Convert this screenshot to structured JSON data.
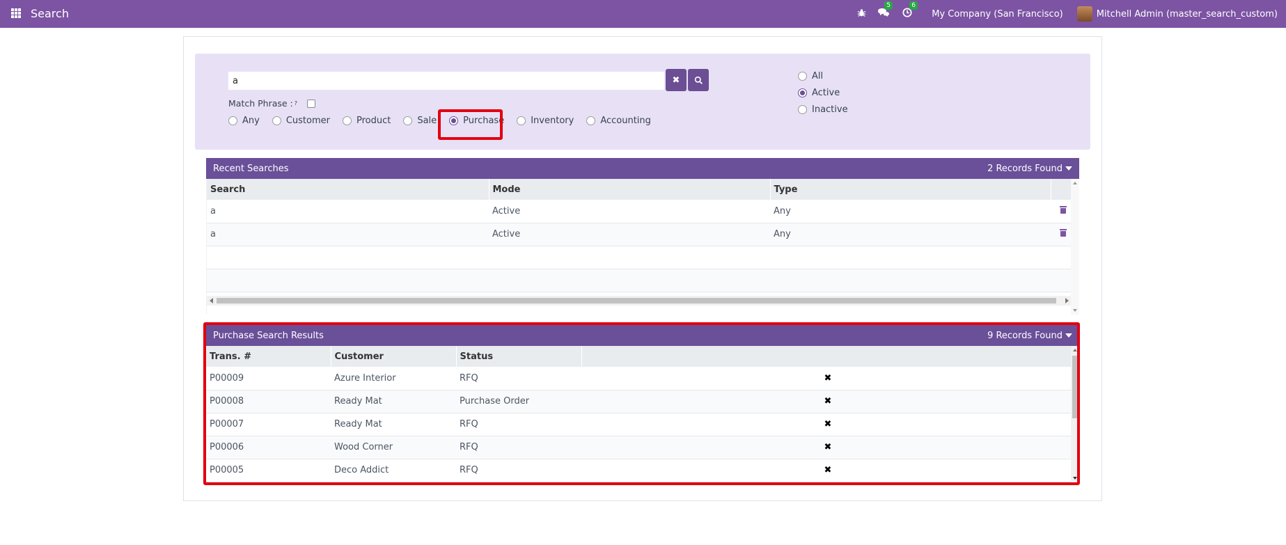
{
  "navbar": {
    "app_title": "Search",
    "messages_count": "5",
    "activities_count": "6",
    "company": "My Company (San Francisco)",
    "user": "Mitchell Admin (master_search_custom)"
  },
  "search": {
    "query": "a",
    "match_phrase_label": "Match Phrase :",
    "match_phrase_help": "?",
    "clear_icon": "✖",
    "search_icon": "search-icon",
    "types": [
      "Any",
      "Customer",
      "Product",
      "Sale",
      "Purchase",
      "Inventory",
      "Accounting"
    ],
    "selected_type": "Purchase",
    "status_options": [
      "All",
      "Active",
      "Inactive"
    ],
    "selected_status": "Active"
  },
  "recent": {
    "title": "Recent Searches",
    "count_label": "2 Records Found",
    "columns": [
      "Search",
      "Mode",
      "Type"
    ],
    "rows": [
      {
        "search": "a",
        "mode": "Active",
        "type": "Any"
      },
      {
        "search": "a",
        "mode": "Active",
        "type": "Any"
      }
    ]
  },
  "results": {
    "title": "Purchase Search Results",
    "count_label": "9 Records Found",
    "columns": [
      "Trans. #",
      "Customer",
      "Status"
    ],
    "rows": [
      {
        "trans": "P00009",
        "customer": "Azure Interior",
        "status": "RFQ",
        "action": "✖"
      },
      {
        "trans": "P00008",
        "customer": "Ready Mat",
        "status": "Purchase Order",
        "action": "✖"
      },
      {
        "trans": "P00007",
        "customer": "Ready Mat",
        "status": "RFQ",
        "action": "✖"
      },
      {
        "trans": "P00006",
        "customer": "Wood Corner",
        "status": "RFQ",
        "action": "✖"
      },
      {
        "trans": "P00005",
        "customer": "Deco Addict",
        "status": "RFQ",
        "action": "✖"
      }
    ]
  },
  "colors": {
    "navbar": "#7c54a3",
    "panel_header": "#6a4f99",
    "search_panel_bg": "#e8e1f6",
    "highlight": "#e3000f"
  }
}
